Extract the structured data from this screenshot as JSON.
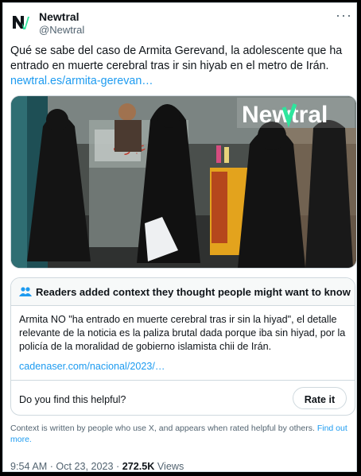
{
  "author": {
    "name": "Newtral",
    "handle": "@Newtral",
    "avatar_text": "N"
  },
  "tweet": {
    "text": "Qué se sabe del caso de Armita Gerevand, la adolescente que ha entrado en muerte cerebral tras ir sin hiyab en el metro de Irán.",
    "link": "newtral.es/armita-gerevan…",
    "more_icon": "ellipsis-icon",
    "image_watermark": "Newtral",
    "image_sign_text": "عبارت"
  },
  "community_note": {
    "title": "Readers added context they thought people might want to know",
    "icon": "people-icon",
    "body": "Armita NO \"ha entrado en muerte cerebral tras ir sin la hiyad\", el detalle relevante de la noticia es la paliza brutal dada porque iba sin hiyad,  por la policía de la moralidad de gobierno islamista chii de Irán.",
    "link": "cadenaser.com/nacional/2023/…",
    "helpful_question": "Do you find this helpful?",
    "rate_button": "Rate it"
  },
  "footnote": {
    "text": "Context is written by people who use X, and appears when rated helpful by others.",
    "link": "Find out more."
  },
  "meta": {
    "time": "9:54 AM",
    "separator": "·",
    "date": "Oct 23, 2023",
    "views_count": "272.5K",
    "views_label": "Views"
  },
  "colors": {
    "accent": "#1d9bf0",
    "text": "#0f1419",
    "muted": "#536471",
    "border": "#cfd9de",
    "brand_green": "#2ee59d"
  }
}
